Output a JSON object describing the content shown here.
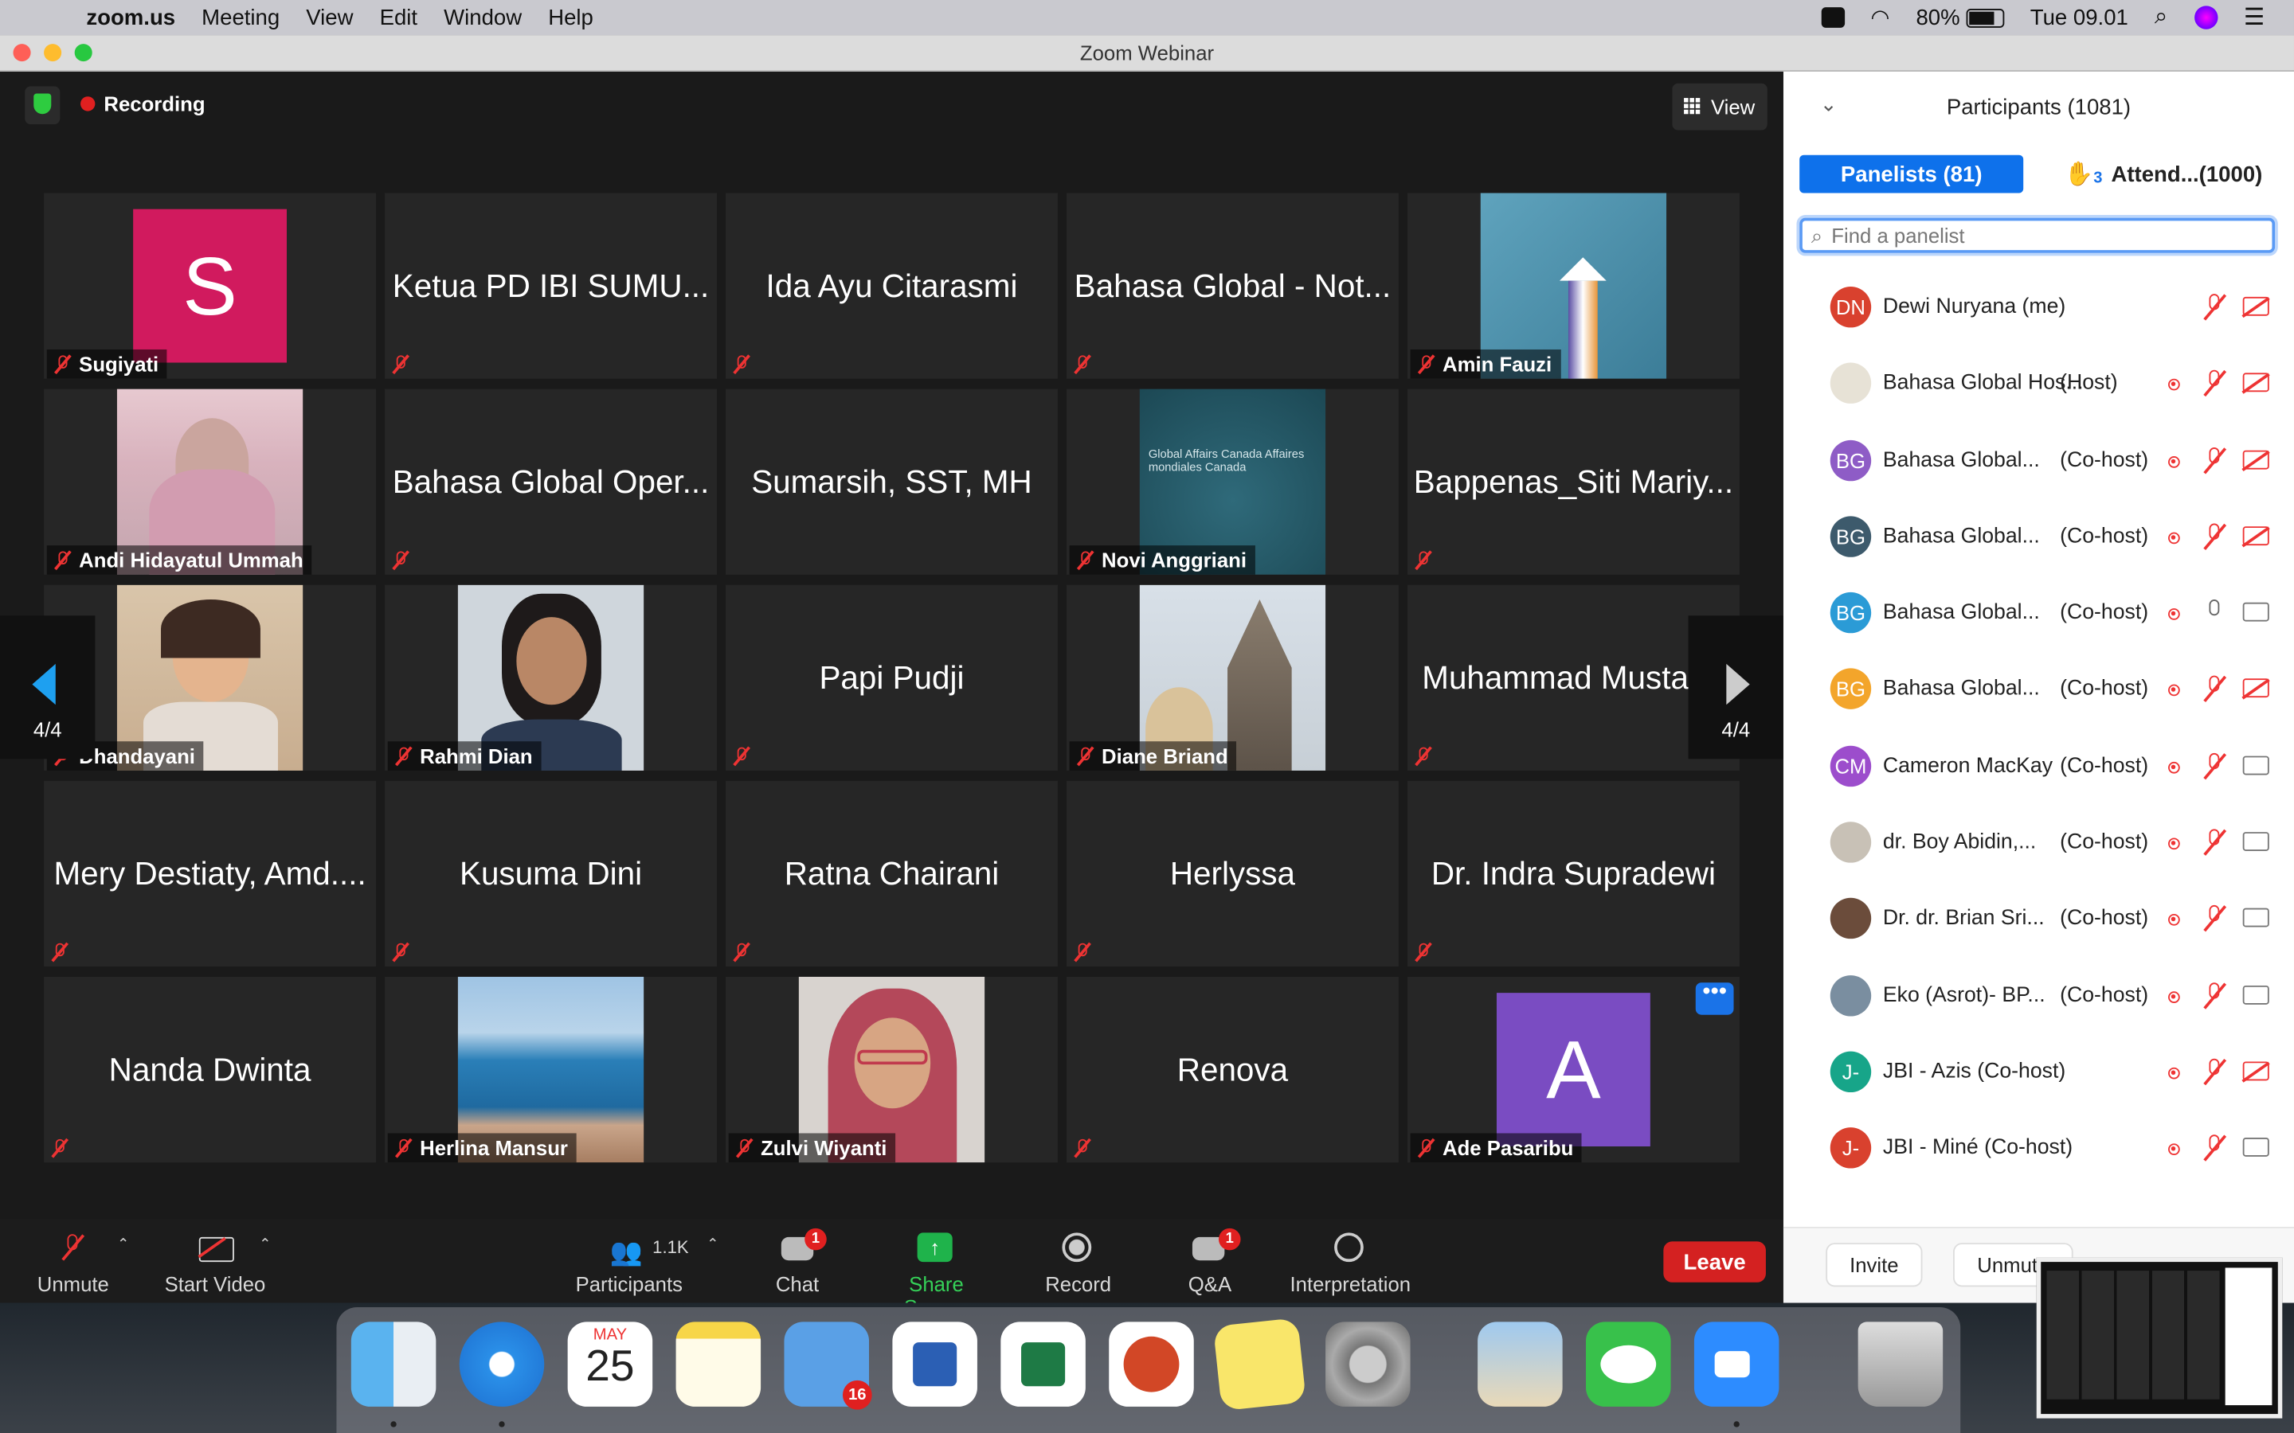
{
  "menubar": {
    "app": "zoom.us",
    "items": [
      "Meeting",
      "View",
      "Edit",
      "Window",
      "Help"
    ],
    "battery": "80%",
    "clock": "Tue 09.01"
  },
  "window": {
    "title": "Zoom Webinar"
  },
  "meeting": {
    "recording_label": "Recording",
    "view_label": "View",
    "page_left": "4/4",
    "page_right": "4/4",
    "tiles": [
      {
        "name": "Sugiyati",
        "kind": "avatar",
        "avatar_letter": "S",
        "label": true
      },
      {
        "name": "Ketua PD IBI SUMU...",
        "kind": "text"
      },
      {
        "name": "Ida Ayu Citarasmi",
        "kind": "text"
      },
      {
        "name": "Bahasa Global - Not...",
        "kind": "text"
      },
      {
        "name": "Amin Fauzi",
        "kind": "photo",
        "label": true
      },
      {
        "name": "Andi Hidayatul Ummah",
        "kind": "photo",
        "label": true
      },
      {
        "name": "Bahasa Global Oper...",
        "kind": "text"
      },
      {
        "name": "Sumarsih, SST, MH",
        "kind": "text"
      },
      {
        "name": "Novi Anggriani",
        "kind": "photo",
        "label": true,
        "slide_text": "Global Affairs Canada     Affaires mondiales Canada"
      },
      {
        "name": "Bappenas_Siti Mariy...",
        "kind": "text"
      },
      {
        "name": "Dhandayani",
        "kind": "photo",
        "label": true
      },
      {
        "name": "Rahmi Dian",
        "kind": "photo",
        "label": true
      },
      {
        "name": "Papi Pudji",
        "kind": "text"
      },
      {
        "name": "Diane Briand",
        "kind": "photo",
        "label": true
      },
      {
        "name": "Muhammad Mustag...",
        "kind": "text"
      },
      {
        "name": "Mery Destiaty, Amd....",
        "kind": "text"
      },
      {
        "name": "Kusuma Dini",
        "kind": "text"
      },
      {
        "name": "Ratna Chairani",
        "kind": "text"
      },
      {
        "name": "Herlyssa",
        "kind": "text"
      },
      {
        "name": "Dr. Indra Supradewi",
        "kind": "text"
      },
      {
        "name": "Nanda Dwinta",
        "kind": "text"
      },
      {
        "name": "Herlina Mansur",
        "kind": "photo",
        "label": true
      },
      {
        "name": "Zulvi Wiyanti",
        "kind": "photo",
        "label": true
      },
      {
        "name": "Renova",
        "kind": "text"
      },
      {
        "name": "Ade Pasaribu",
        "kind": "avatar",
        "avatar_letter": "A",
        "label": true
      }
    ],
    "more_label": "•••"
  },
  "toolbar": {
    "unmute": "Unmute",
    "start_video": "Start Video",
    "participants": "Participants",
    "participants_count": "1.1K",
    "chat": "Chat",
    "chat_badge": "1",
    "share_screen": "Share Screen",
    "record": "Record",
    "qa": "Q&A",
    "qa_badge": "1",
    "interpretation": "Interpretation",
    "leave": "Leave"
  },
  "panel": {
    "title": "Participants (1081)",
    "tab_panelists": "Panelists (81)",
    "tab_attendees": "Attend...(1000)",
    "raised_hands": "3",
    "search_placeholder": "Find a panelist",
    "participants": [
      {
        "initials": "DN",
        "name": "Dewi Nuryana (me)",
        "role": "",
        "color": "#d9412e",
        "rec": false,
        "mic": "off",
        "cam": "off"
      },
      {
        "initials": "",
        "name": "Bahasa Global Hos...",
        "role": "(Host)",
        "color": "#e7e2d6",
        "rec": true,
        "mic": "off",
        "cam": "off"
      },
      {
        "initials": "BG",
        "name": "Bahasa Global...",
        "role": "(Co-host)",
        "color": "#8e5cc6",
        "rec": true,
        "mic": "off",
        "cam": "off"
      },
      {
        "initials": "BG",
        "name": "Bahasa Global...",
        "role": "(Co-host)",
        "color": "#3d5a6c",
        "rec": true,
        "mic": "off",
        "cam": "off"
      },
      {
        "initials": "BG",
        "name": "Bahasa Global...",
        "role": "(Co-host)",
        "color": "#2b9bd6",
        "rec": true,
        "mic": "on",
        "cam": "on"
      },
      {
        "initials": "BG",
        "name": "Bahasa Global...",
        "role": "(Co-host)",
        "color": "#f3a52b",
        "rec": true,
        "mic": "off",
        "cam": "off"
      },
      {
        "initials": "CM",
        "name": "Cameron MacKay",
        "role": "(Co-host)",
        "color": "#9c4dcc",
        "rec": true,
        "mic": "off",
        "cam": "on"
      },
      {
        "initials": "",
        "name": "dr. Boy Abidin,...",
        "role": "(Co-host)",
        "color": "#c8c1b6",
        "rec": true,
        "mic": "off",
        "cam": "on"
      },
      {
        "initials": "",
        "name": "Dr. dr. Brian Sri...",
        "role": "(Co-host)",
        "color": "#6b4c3b",
        "rec": true,
        "mic": "off",
        "cam": "on"
      },
      {
        "initials": "",
        "name": "Eko (Asrot)- BP...",
        "role": "(Co-host)",
        "color": "#7a8ea0",
        "rec": true,
        "mic": "off",
        "cam": "on"
      },
      {
        "initials": "J-",
        "name": "JBI - Azis (Co-host)",
        "role": "",
        "color": "#17a589",
        "rec": true,
        "mic": "off",
        "cam": "off"
      },
      {
        "initials": "J-",
        "name": "JBI - Miné (Co-host)",
        "role": "",
        "color": "#d9412e",
        "rec": true,
        "mic": "off",
        "cam": "on"
      }
    ],
    "invite": "Invite",
    "unmute_me": "Unmute"
  },
  "dock": {
    "calendar_month": "MAY",
    "calendar_day": "25",
    "launchpad_badge": "16"
  }
}
